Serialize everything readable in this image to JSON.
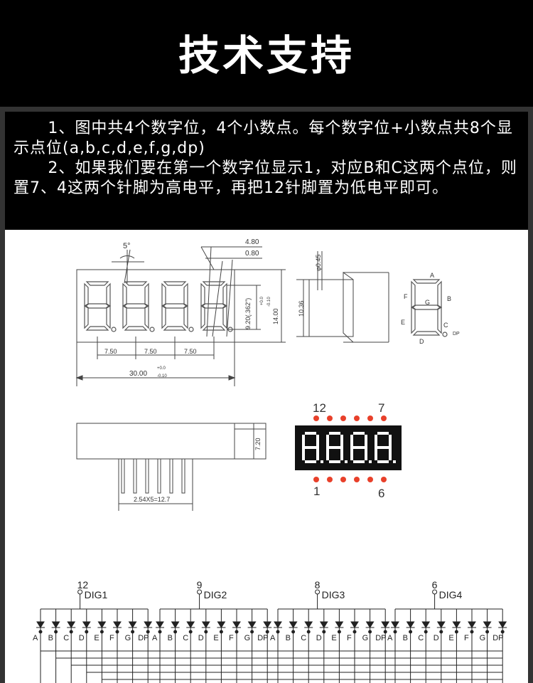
{
  "header": {
    "title": "技术支持"
  },
  "notes": [
    "1、图中共4个数字位，4个小数点。每个数字位+小数点共8个显示点位(a,b,c,d,e,f,g,dp)",
    "2、如果我们要在第一个数字位显示1，对应B和C这两个点位，则置7、4这两个针脚为高电平，再把12针脚置为低电平即可。"
  ],
  "drawing": {
    "angle": "5°",
    "dim_480": "4.80",
    "dim_080": "0.80",
    "dim_045": "φ0.45",
    "dim_750": [
      "7.50",
      "7.50",
      "7.50"
    ],
    "dim_3000": "30.00",
    "tol_plus": "+0.0",
    "tol_minus": "-0.10",
    "dim_920": "9.20(.362\")",
    "dim_1400": "14.00",
    "dim_1036": "10.36",
    "dim_720": "7.20",
    "pitch": "2.54X5=12.7"
  },
  "segment_labels": {
    "a": "A",
    "b": "B",
    "c": "C",
    "d": "D",
    "e": "E",
    "f": "F",
    "g": "G",
    "dp": "DP"
  },
  "photo": {
    "pin_top_left": "12",
    "pin_top_right": "7",
    "pin_bottom_left": "1",
    "pin_bottom_right": "6",
    "digits": "8.8.8.8."
  },
  "schematic": {
    "digits": [
      {
        "pin": "12",
        "name": "DIG1"
      },
      {
        "pin": "9",
        "name": "DIG2"
      },
      {
        "pin": "8",
        "name": "DIG3"
      },
      {
        "pin": "6",
        "name": "DIG4"
      }
    ],
    "segments": [
      "A",
      "B",
      "C",
      "D",
      "E",
      "F",
      "G",
      "DP"
    ]
  },
  "colors": {
    "pin_red": "#e8402a",
    "digit_red": "#ffffff"
  }
}
